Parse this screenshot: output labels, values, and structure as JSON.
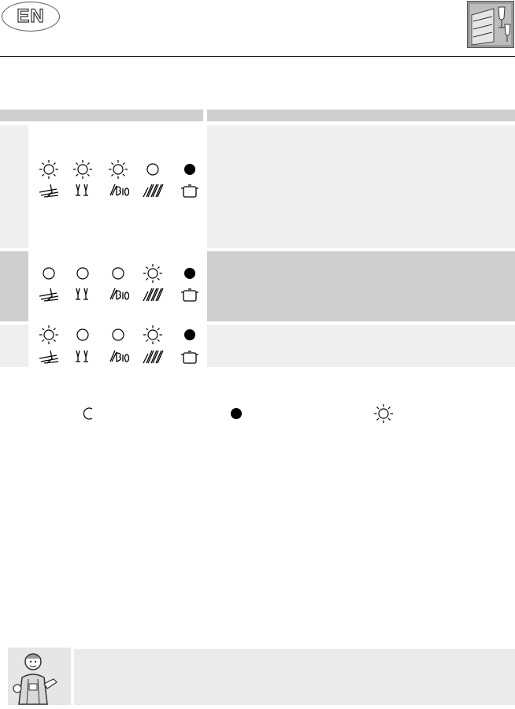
{
  "header": {
    "language_badge": "EN",
    "logo_icon": "dishwasher-glasses-icon"
  },
  "table": {
    "rows": [
      {
        "indicators": [
          {
            "state": "flashing",
            "symbol": "pots-pans-icon"
          },
          {
            "state": "flashing",
            "symbol": "glasses-icon"
          },
          {
            "state": "flashing",
            "symbol": "bio-icon"
          },
          {
            "state": "off",
            "symbol": "plates-icon"
          },
          {
            "state": "on",
            "symbol": "pot-icon"
          }
        ]
      },
      {
        "indicators": [
          {
            "state": "off",
            "symbol": "pots-pans-icon"
          },
          {
            "state": "off",
            "symbol": "glasses-icon"
          },
          {
            "state": "off",
            "symbol": "bio-icon"
          },
          {
            "state": "flashing",
            "symbol": "plates-icon"
          },
          {
            "state": "on",
            "symbol": "pot-icon"
          }
        ]
      },
      {
        "indicators": [
          {
            "state": "flashing",
            "symbol": "pots-pans-icon"
          },
          {
            "state": "off",
            "symbol": "glasses-icon"
          },
          {
            "state": "off",
            "symbol": "bio-icon"
          },
          {
            "state": "flashing",
            "symbol": "plates-icon"
          },
          {
            "state": "on",
            "symbol": "pot-icon"
          }
        ]
      }
    ]
  },
  "legend": [
    {
      "state": "off",
      "icon": "open-circle-icon"
    },
    {
      "state": "on",
      "icon": "filled-circle-icon"
    },
    {
      "state": "flashing",
      "icon": "flashing-light-icon"
    }
  ],
  "tip": {
    "icon": "technician-icon"
  },
  "colors": {
    "header_band": "#cfcfcf",
    "row_light": "#efefef",
    "row_dark": "#cfcfcf",
    "tip_background": "#ebebeb"
  }
}
